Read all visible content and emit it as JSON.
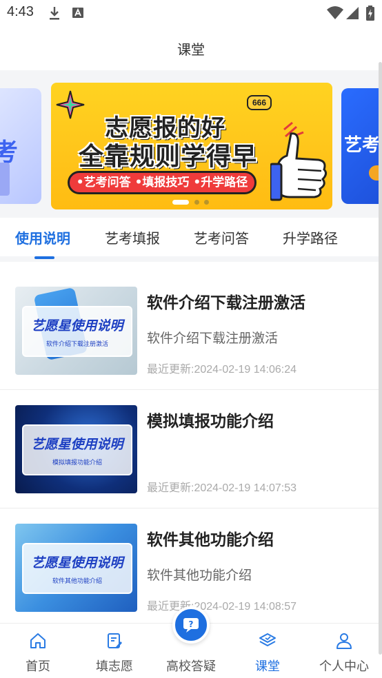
{
  "status_bar": {
    "time": "4:43"
  },
  "header": {
    "title": "课堂"
  },
  "banner": {
    "prev_text": "考",
    "next_text": "艺考",
    "line1": "志愿报的好",
    "line2": "全靠规则学得早",
    "pill": "•艺考问答 •填报技巧 •升学路径",
    "bubble": "666",
    "accent": "#ffc41a"
  },
  "tabs": [
    {
      "label": "使用说明",
      "active": true
    },
    {
      "label": "艺考填报",
      "active": false
    },
    {
      "label": "艺考问答",
      "active": false
    },
    {
      "label": "升学路径",
      "active": false
    }
  ],
  "items": [
    {
      "title": "软件介绍下载注册激活",
      "desc": "软件介绍下载注册激活",
      "date": "最近更新:2024-02-19 14:06:24",
      "thumb_title": "艺愿星使用说明",
      "thumb_sub": "软件介绍下载注册激活"
    },
    {
      "title": "模拟填报功能介绍",
      "desc": "",
      "date": "最近更新:2024-02-19 14:07:53",
      "thumb_title": "艺愿星使用说明",
      "thumb_sub": "模拟填报功能介绍"
    },
    {
      "title": "软件其他功能介绍",
      "desc": "软件其他功能介绍",
      "date": "最近更新:2024-02-19 14:08:57",
      "thumb_title": "艺愿星使用说明",
      "thumb_sub": "软件其他功能介绍"
    }
  ],
  "nav": [
    {
      "label": "首页",
      "icon": "home-icon"
    },
    {
      "label": "填志愿",
      "icon": "edit-form-icon"
    },
    {
      "label": "高校答疑",
      "icon": "question-chat-icon"
    },
    {
      "label": "课堂",
      "icon": "layers-icon",
      "active": true
    },
    {
      "label": "个人中心",
      "icon": "user-icon"
    }
  ],
  "colors": {
    "primary": "#1e6fe0",
    "banner_red": "#ef3b3b"
  }
}
